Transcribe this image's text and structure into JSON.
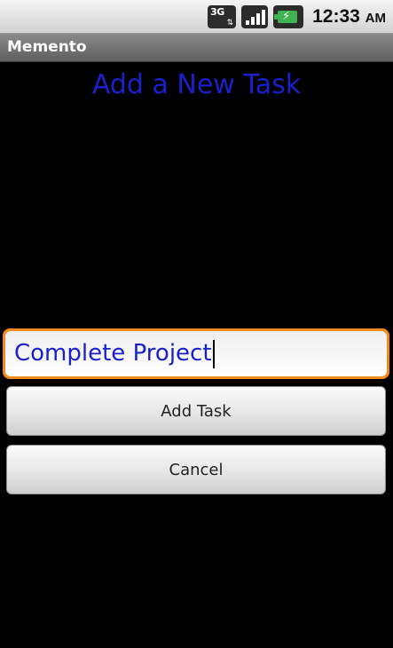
{
  "status_bar": {
    "network_label": "3G",
    "icons": [
      "network-3g-icon",
      "signal-strength-icon",
      "battery-charging-icon"
    ],
    "time": "12:33",
    "ampm": "AM"
  },
  "app": {
    "title": "Memento"
  },
  "screen": {
    "heading": "Add a New Task",
    "task_input_value": "Complete Project",
    "add_button_label": "Add Task",
    "cancel_button_label": "Cancel"
  },
  "colors": {
    "heading": "#1a20cc",
    "input_focus_border": "#f08a1a",
    "battery_green": "#3fb34f",
    "background": "#000000"
  }
}
